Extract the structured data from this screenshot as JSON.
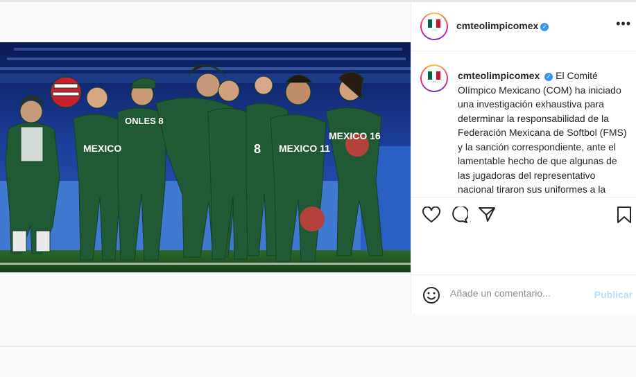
{
  "post": {
    "username": "cmteolimpicomex",
    "verified_icon": "verified-badge-icon",
    "caption": "El Comité Olímpico Mexicano (COM) ha iniciado una investigación exhaustiva para determinar la responsabilidad de la Federación Mexicana de Softbol (FMS) y la sanción correspondiente, ante el lamentable hecho de que algunas de las jugadoras del representativo nacional tiraron sus uniformes a la basura al término de su participación",
    "photo": {
      "jerseys": [
        "ONLES 8",
        "MEXICO",
        "MEXICO 11",
        "MEXICO 16",
        "8"
      ]
    }
  },
  "actions": {
    "icons": [
      "heart-icon",
      "comment-icon",
      "share-icon",
      "bookmark-icon"
    ]
  },
  "comment": {
    "placeholder": "Añade un comentario...",
    "publish_label": "Publicar"
  },
  "colors": {
    "uniform": "#1f5a34",
    "verified": "#3897f0",
    "publish_disabled": "#b2dffc",
    "flag_green": "#006847",
    "flag_red": "#ce1126"
  }
}
